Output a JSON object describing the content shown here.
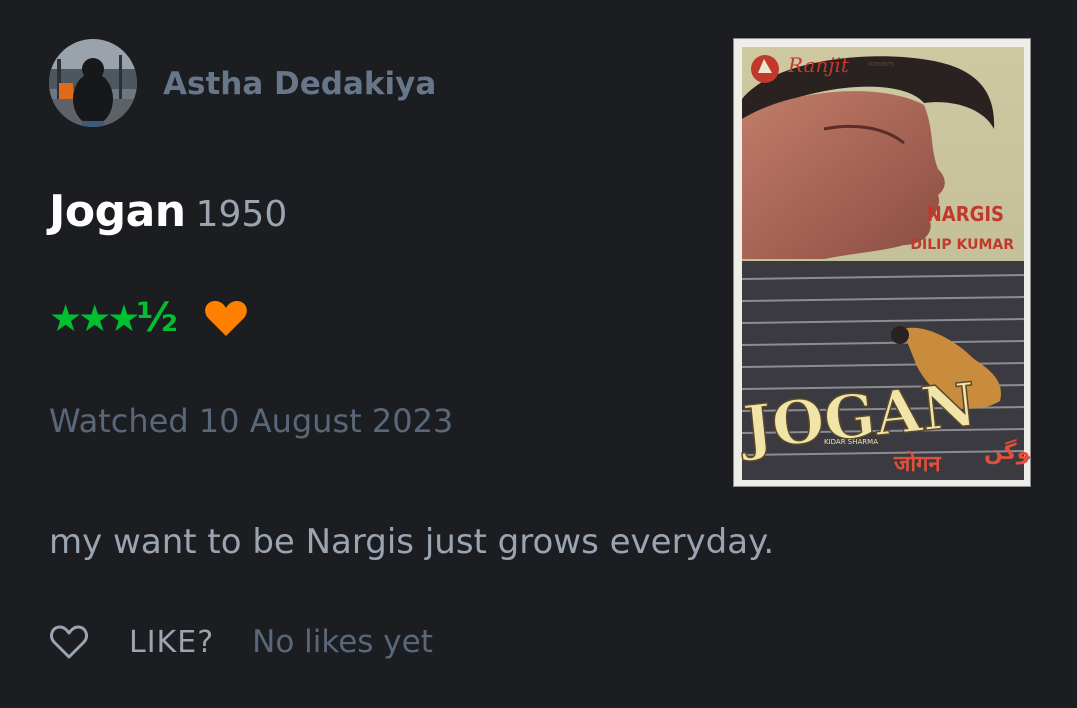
{
  "review": {
    "username": "Astha Dedakiya",
    "film_title": "Jogan",
    "film_year": "1950",
    "rating_stars": "★★★",
    "rating_half": "½",
    "rating_value": 3.5,
    "liked": true,
    "watched_text": "Watched 10 August 2023",
    "text": "my want to be Nargis just grows everyday."
  },
  "actions": {
    "like_label": "LIKE?",
    "likes_count": "No likes yet"
  },
  "poster": {
    "studio": "Ranjit",
    "presents": "PRESENTS",
    "cast_1": "NARGIS",
    "cast_2": "DILIP KUMAR",
    "title": "JOGAN",
    "credit": "KIDAR SHARMA",
    "hindi_title": "जोगन",
    "urdu_title": "جوگن"
  },
  "colors": {
    "background": "#1b1d21",
    "star": "#00c030",
    "heart": "#ff8000",
    "muted": "#5a6778",
    "text": "#9aa5b1"
  }
}
